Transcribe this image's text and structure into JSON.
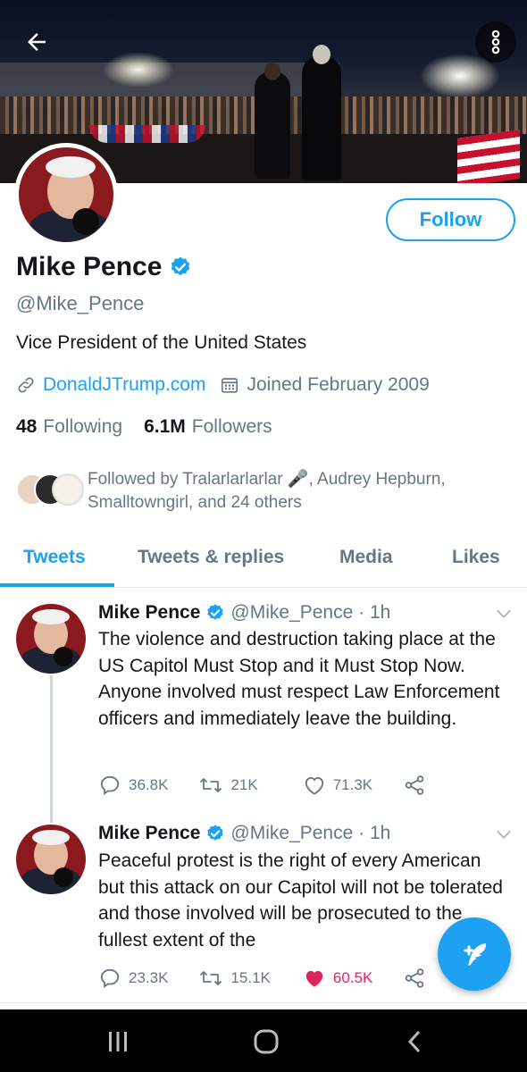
{
  "header": {
    "back_icon": "arrow-left-icon",
    "more_icon": "more-vertical-icon"
  },
  "profile": {
    "name": "Mike Pence",
    "handle": "@Mike_Pence",
    "bio": "Vice President of the United States",
    "website": "DonaldJTrump.com",
    "joined": "Joined February 2009",
    "following_count": "48",
    "following_label": "Following",
    "followers_count": "6.1M",
    "followers_label": "Followers",
    "follow_button": "Follow",
    "followed_by": "Followed by Tralarlarlarlar 🎤, Audrey Hepburn, Smalltowngirl, and 24 others"
  },
  "tabs": [
    {
      "label": "Tweets",
      "active": true
    },
    {
      "label": "Tweets & replies",
      "active": false
    },
    {
      "label": "Media",
      "active": false
    },
    {
      "label": "Likes",
      "active": false
    }
  ],
  "tweets": [
    {
      "name": "Mike Pence",
      "handle": "@Mike_Pence · 1h",
      "text": "The violence and destruction taking place at the US Capitol Must Stop and it Must Stop Now. Anyone involved must respect Law Enforcement officers and immediately leave the building.",
      "replies": "36.8K",
      "retweets": "21K",
      "likes": "71.3K",
      "liked": false
    },
    {
      "name": "Mike Pence",
      "handle": "@Mike_Pence · 1h",
      "text": "Peaceful protest is the right of every American but this attack on our Capitol will not be tolerated and those involved will be prosecuted to the fullest extent of the",
      "replies": "23.3K",
      "retweets": "15.1K",
      "likes": "60.5K",
      "liked": true
    }
  ],
  "colors": {
    "accent": "#1da1f2",
    "like": "#e0245e",
    "secondary_text": "#657786"
  }
}
